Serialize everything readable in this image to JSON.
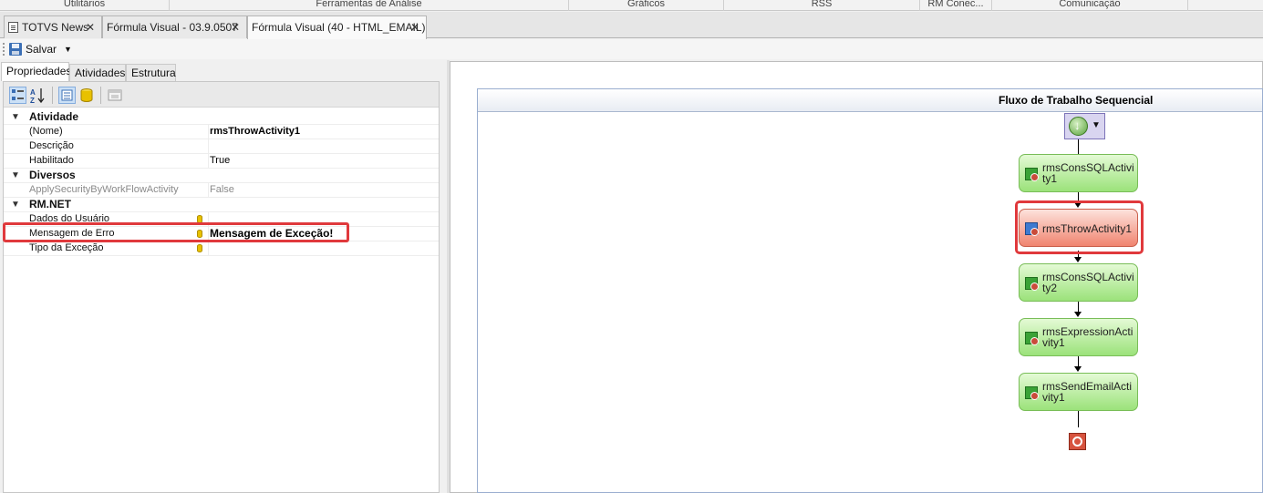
{
  "ribbon_categories": [
    "Utilitários",
    "Ferramentas de Análise",
    "Gráficos",
    "RSS",
    "RM Conec...",
    "Comunicação"
  ],
  "doc_tabs": [
    {
      "label": "TOTVS News",
      "icon": "news-icon"
    },
    {
      "label": "Fórmula Visual - 03.9.0507"
    },
    {
      "label": "Fórmula Visual (40 - HTML_EMAIL)",
      "active": true
    }
  ],
  "toolbar": {
    "save_label": "Salvar"
  },
  "left_tabs": [
    "Propriedades",
    "Atividades",
    "Estrutura"
  ],
  "property_grid": {
    "categories": [
      {
        "name": "Atividade",
        "rows": [
          {
            "name": "(Nome)",
            "value": "rmsThrowActivity1"
          },
          {
            "name": "Descrição",
            "value": ""
          },
          {
            "name": "Habilitado",
            "value": "True"
          }
        ]
      },
      {
        "name": "Diversos",
        "rows": [
          {
            "name": "ApplySecurityByWorkFlowActivity",
            "value": "False"
          }
        ]
      },
      {
        "name": "RM.NET",
        "rows": [
          {
            "name": "Dados do Usuário",
            "value": ""
          },
          {
            "name": "Mensagem de Erro",
            "value": "Mensagem de Exceção!"
          },
          {
            "name": "Tipo da Exceção",
            "value": ""
          }
        ]
      }
    ]
  },
  "designer": {
    "title": "Fluxo de Trabalho Sequencial",
    "activities": [
      "rmsConsSQLActivity1",
      "rmsThrowActivity1",
      "rmsConsSQLActivity2",
      "rmsExpressionActivity1",
      "rmsSendEmailActivity1"
    ],
    "highlight_color": "#e0393c"
  }
}
